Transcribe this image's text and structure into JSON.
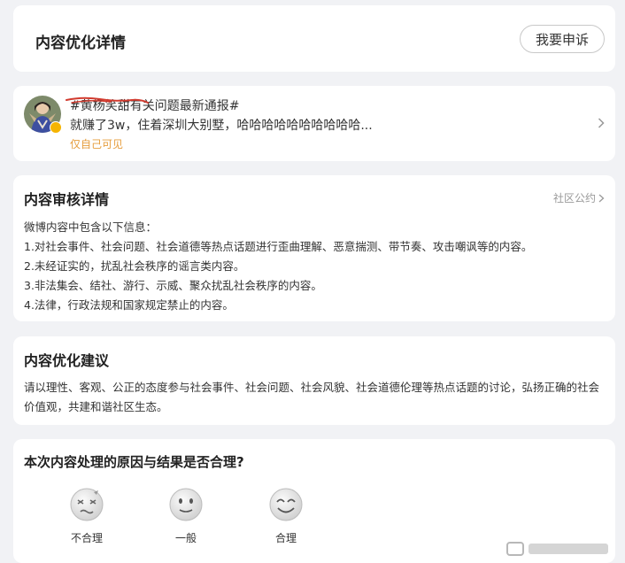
{
  "header": {
    "title": "内容优化详情",
    "appeal_label": "我要申诉"
  },
  "post": {
    "topic": "#黄杨笑甜有关问题最新通报#",
    "text": "就赚了3w，住着深圳大别墅，哈哈哈哈哈哈哈哈哈哈...",
    "visibility": "仅自己可见",
    "avatar_icon": "user-avatar",
    "chevron_icon": "chevron-right-icon"
  },
  "review": {
    "title": "内容审核详情",
    "rules_link": "社区公约",
    "intro": "微博内容中包含以下信息：",
    "items": [
      "1.对社会事件、社会问题、社会道德等热点话题进行歪曲理解、恶意揣测、带节奏、攻击嘲讽等的内容。",
      "2.未经证实的，扰乱社会秩序的谣言类内容。",
      "3.非法集会、结社、游行、示威、聚众扰乱社会秩序的内容。",
      "4.法律，行政法规和国家规定禁止的内容。"
    ]
  },
  "suggestion": {
    "title": "内容优化建议",
    "text": "请以理性、客观、公正的态度参与社会事件、社会问题、社会风貌、社会道德伦理等热点话题的讨论，弘扬正确的社会价值观，共建和谐社区生态。"
  },
  "feedback": {
    "question": "本次内容处理的原因与结果是否合理?",
    "options": [
      {
        "label": "不合理",
        "icon": "dizzy-face-icon"
      },
      {
        "label": "一般",
        "icon": "neutral-face-icon"
      },
      {
        "label": "合理",
        "icon": "happy-face-icon"
      }
    ]
  },
  "colors": {
    "background": "#f1f2f5",
    "card": "#ffffff",
    "visibility_text": "#e69d3c",
    "verify_badge": "#f5b400",
    "scribble": "#d23b2f"
  }
}
